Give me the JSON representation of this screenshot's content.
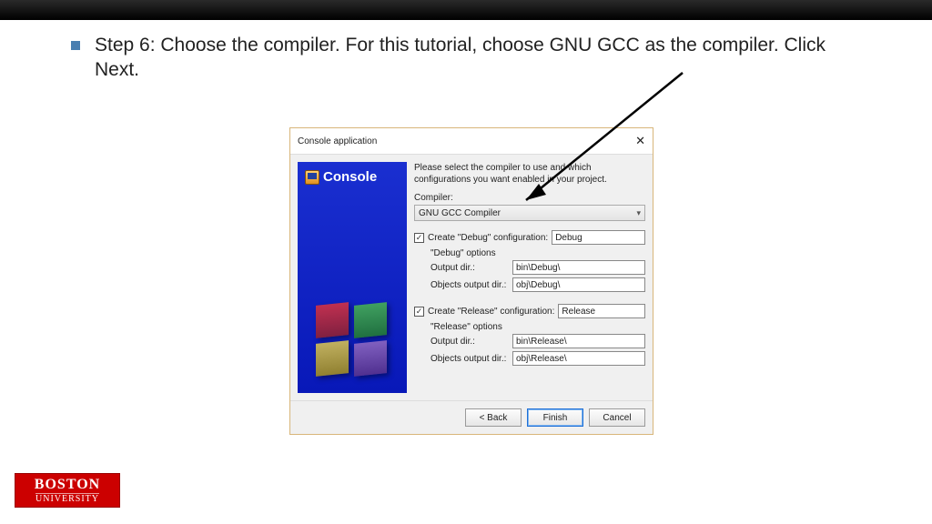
{
  "step_text": "Step 6: Choose the compiler.  For this tutorial, choose GNU GCC as the compiler.  Click Next.",
  "dialog": {
    "title": "Console application",
    "side_label": "Console",
    "instruction": "Please select the compiler to use and which configurations you want enabled in your project.",
    "compiler_label": "Compiler:",
    "compiler_value": "GNU GCC Compiler",
    "debug": {
      "check_label": "Create \"Debug\" configuration:",
      "name": "Debug",
      "options_label": "\"Debug\" options",
      "output_dir_label": "Output dir.:",
      "output_dir_value": "bin\\Debug\\",
      "objects_dir_label": "Objects output dir.:",
      "objects_dir_value": "obj\\Debug\\"
    },
    "release": {
      "check_label": "Create \"Release\" configuration:",
      "name": "Release",
      "options_label": "\"Release\" options",
      "output_dir_label": "Output dir.:",
      "output_dir_value": "bin\\Release\\",
      "objects_dir_label": "Objects output dir.:",
      "objects_dir_value": "obj\\Release\\"
    },
    "buttons": {
      "back": "< Back",
      "finish": "Finish",
      "cancel": "Cancel"
    }
  },
  "logo": {
    "line1": "BOSTON",
    "line2": "UNIVERSITY"
  }
}
